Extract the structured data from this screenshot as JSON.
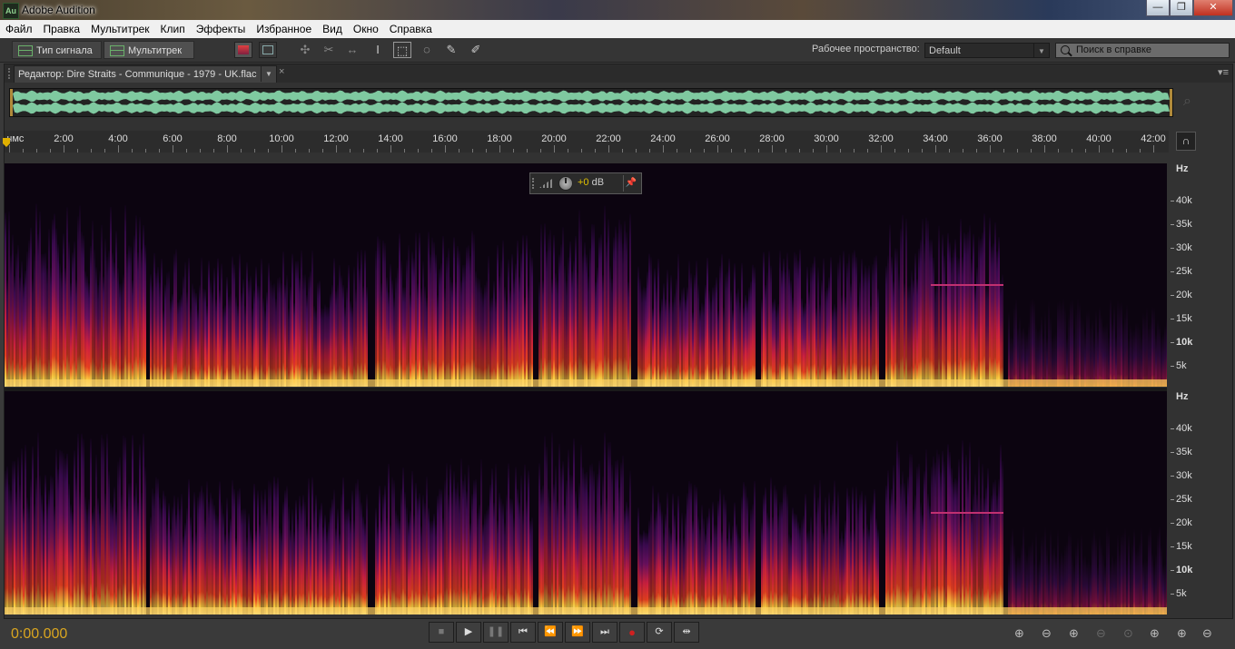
{
  "app": {
    "title": "Adobe Audition",
    "icon_text": "Au",
    "window_buttons": [
      "—",
      "❐",
      "✕"
    ]
  },
  "menu": [
    "Файл",
    "Правка",
    "Мультитрек",
    "Клип",
    "Эффекты",
    "Избранное",
    "Вид",
    "Окно",
    "Справка"
  ],
  "toolbar": {
    "waveform_label": "Тип сигнала",
    "multitrack_label": "Мультитрек",
    "workspace_label": "Рабочее пространство:",
    "workspace_value": "Default",
    "help_search_placeholder": "Поиск в справке"
  },
  "editor": {
    "tab_title": "Редактор: Dire Straits - Communique - 1979 - UK.flac",
    "tab_close": "×",
    "panel_menu": "▾≡"
  },
  "ruler": {
    "labels": [
      "чмс",
      "2:00",
      "4:00",
      "6:00",
      "8:00",
      "10:00",
      "12:00",
      "14:00",
      "16:00",
      "18:00",
      "20:00",
      "22:00",
      "24:00",
      "26:00",
      "28:00",
      "30:00",
      "32:00",
      "34:00",
      "36:00",
      "38:00",
      "40:00",
      "42:00"
    ]
  },
  "hz_axis": {
    "unit": "Hz",
    "labels": [
      "40k",
      "35k",
      "30k",
      "25k",
      "20k",
      "15k",
      "10k",
      "5k"
    ]
  },
  "hud": {
    "value": "+0",
    "unit": "dB"
  },
  "transport": {
    "timecode": "0:00.000",
    "buttons": [
      "stop",
      "play",
      "pause",
      "go-to-start",
      "rewind",
      "fast-forward",
      "go-to-end",
      "record",
      "loop",
      "skip-selection"
    ]
  },
  "colors": {
    "accent": "#d9a520",
    "waveform": "#7fc9a0",
    "spectrum_hot": "#ffd040",
    "spectrum_mid": "#d02040",
    "spectrum_low": "#3a0a50",
    "record": "#d02020"
  },
  "icons": {
    "zoom_controls": [
      "zoom-in-amplitude-icon",
      "zoom-out-amplitude-icon",
      "zoom-in-time-icon",
      "zoom-out-time-icon",
      "zoom-to-selection-icon",
      "zoom-in-left-icon",
      "zoom-in-right-icon",
      "zoom-out-full-icon"
    ]
  }
}
